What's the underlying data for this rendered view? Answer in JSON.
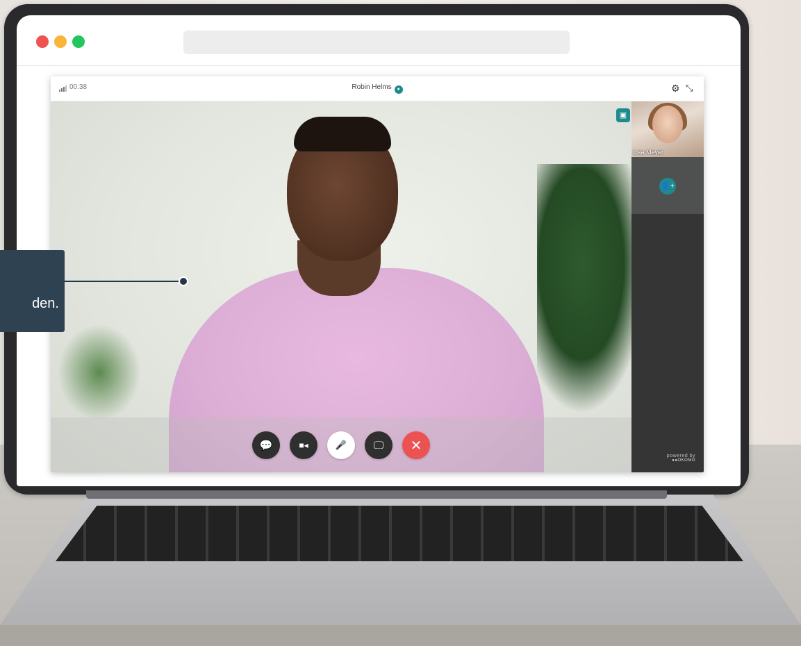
{
  "browser": {
    "traffic_lights": [
      "#ef5350",
      "#f8b53a",
      "#22c55e"
    ]
  },
  "call": {
    "timer": "00:38",
    "caller_name": "Robin Helms",
    "participant_name": "Lisa Meyer",
    "icons": [
      "signal-icon",
      "settings-icon",
      "minimize-icon",
      "contact-icon",
      "add-participant-icon"
    ],
    "controls": [
      {
        "name": "chat-button",
        "icon": "💬"
      },
      {
        "name": "camera-button",
        "icon": "■◂"
      },
      {
        "name": "microphone-button",
        "icon": "🎤"
      },
      {
        "name": "screen-share-button",
        "icon": "🖵"
      },
      {
        "name": "end-call-button",
        "icon": "✕"
      }
    ],
    "powered_by": "powered by",
    "brand": "●●OKOMO"
  },
  "callout": {
    "text": "den."
  },
  "colors": {
    "accent": "#1f8a8d",
    "hangup": "#ec5252",
    "callout_bg": "#2f4251"
  }
}
